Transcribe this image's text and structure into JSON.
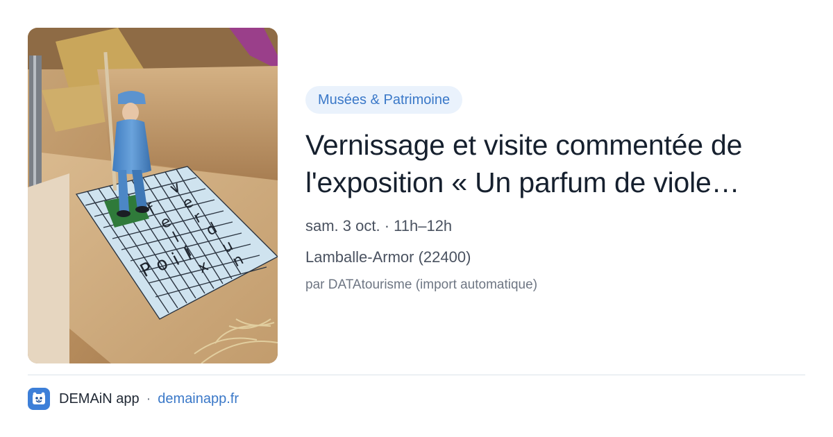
{
  "event": {
    "category": "Musées & Patrimoine",
    "title_line1": "Vernissage et visite commentée de",
    "title_line2": "l'exposition « Un parfum de viole…",
    "datetime": "sam. 3 oct. · 11h–12h",
    "location": "Lamballe-Armor (22400)",
    "source": "par DATAtourisme (import automatique)",
    "image_icon": "toy-soldier-photo",
    "image_words": [
      "verdun",
      "félix",
      "poilu"
    ]
  },
  "footer": {
    "logo_icon": "demain-app-logo-icon",
    "app_name": "DEMAiN app",
    "separator": "·",
    "domain": "demainapp.fr"
  },
  "colors": {
    "accent": "#3a78c8",
    "badge_bg": "#eaf2fc",
    "logo_bg": "#3d7fd8",
    "divider": "#dbe3ea"
  }
}
